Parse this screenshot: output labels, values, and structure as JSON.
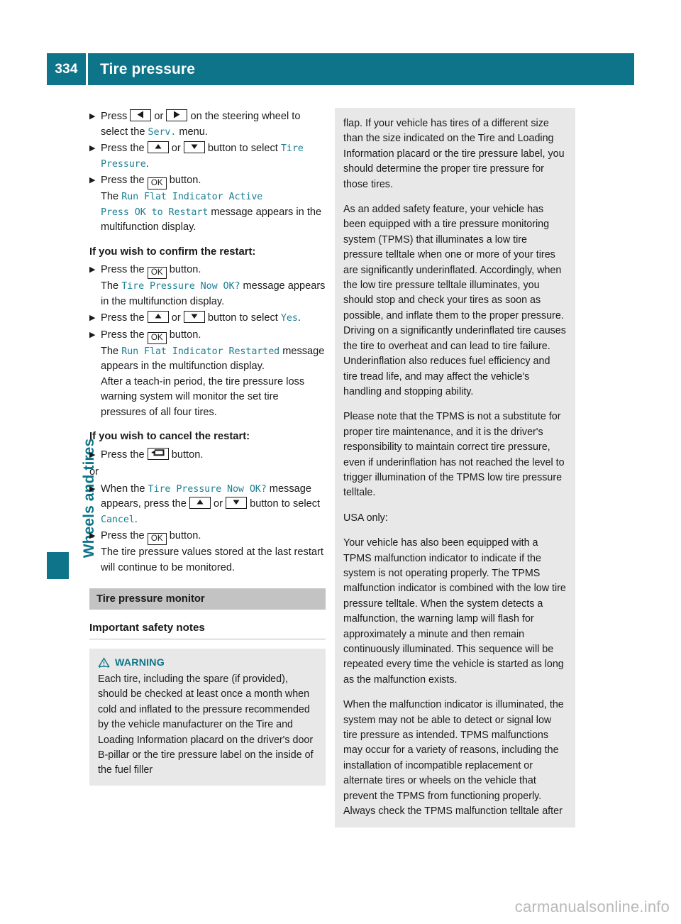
{
  "header": {
    "page_number": "334",
    "title": "Tire pressure",
    "accent_color": "#0d7489"
  },
  "side_tab": {
    "label": "Wheels and tires"
  },
  "keys": {
    "left": "left-arrow",
    "right": "right-arrow",
    "up": "up-arrow",
    "down": "down-arrow",
    "ok": "OK",
    "back": "back-arrow"
  },
  "left_column": {
    "steps_restart": [
      {
        "pre": "Press ",
        "mid": " or ",
        "post": " on the steering wheel to select the ",
        "disp": "Serv.",
        "tail": " menu."
      },
      {
        "pre": "Press the ",
        "mid": " or ",
        "post": " button to select ",
        "disp": "Tire Pressure",
        "tail": "."
      }
    ],
    "step_ok_1": {
      "pre": "Press the ",
      "post": " button.",
      "result_pre": "The ",
      "result_disp_1": "Run Flat Indicator Active",
      "result_disp_2": "Press OK to Restart",
      "result_tail": " message appears in the multifunction display."
    },
    "confirm_heading": "If you wish to confirm the restart:",
    "confirm_steps": [
      {
        "pre": "Press the ",
        "post": " button.",
        "result_pre": "The ",
        "result_disp": "Tire Pressure Now OK?",
        "result_tail": " message appears in the multifunction display."
      },
      {
        "pre": "Press the ",
        "mid": " or ",
        "post": " button to select ",
        "disp": "Yes",
        "tail": "."
      },
      {
        "pre": "Press the ",
        "post": " button.",
        "result_pre": "The ",
        "result_disp": "Run Flat Indicator Restarted",
        "result_tail": " message appears in the multifunction display."
      }
    ],
    "teach_in_note": "After a teach-in period, the tire pressure loss warning system will monitor the set tire pressures of all four tires.",
    "cancel_heading": "If you wish to cancel the restart:",
    "cancel_step_back": {
      "pre": "Press the ",
      "post": " button."
    },
    "or_label": "or",
    "cancel_step_when": {
      "pre": "When the ",
      "disp": "Tire Pressure Now OK?",
      "mid": " message appears, press the ",
      "mid2": " or ",
      "post": " button to select ",
      "disp2": "Cancel",
      "tail": "."
    },
    "cancel_step_ok": {
      "pre": "Press the ",
      "post": " button.",
      "result": "The tire pressure values stored at the last restart will continue to be monitored."
    },
    "section_bar": "Tire pressure monitor",
    "subhead": "Important safety notes",
    "warning": {
      "icon": "warning-triangle-icon",
      "label": "WARNING",
      "text": "Each tire, including the spare (if provided), should be checked at least once a month when cold and inflated to the pressure recommended by the vehicle manufacturer on the Tire and Loading Information placard on the driver's door B-pillar or the tire pressure label on the inside of the fuel filler"
    }
  },
  "right_column": {
    "warning_continued": [
      "flap. If your vehicle has tires of a different size than the size indicated on the Tire and Loading Information placard or the tire pressure label, you should determine the proper tire pressure for those tires.",
      "As an added safety feature, your vehicle has been equipped with a tire pressure monitoring system (TPMS) that illuminates a low tire pressure telltale when one or more of your tires are significantly underinflated. Accordingly, when the low tire pressure telltale illuminates, you should stop and check your tires as soon as possible, and inflate them to the proper pressure. Driving on a significantly underinflated tire causes the tire to overheat and can lead to tire failure. Underinflation also reduces fuel efficiency and tire tread life, and may affect the vehicle's handling and stopping ability.",
      "Please note that the TPMS is not a substitute for proper tire maintenance, and it is the driver's responsibility to maintain correct tire pressure, even if underinflation has not reached the level to trigger illumination of the TPMS low tire pressure telltale.",
      "USA only:",
      "Your vehicle has also been equipped with a TPMS malfunction indicator to indicate if the system is not operating properly. The TPMS malfunction indicator is combined with the low tire pressure telltale. When the system detects a malfunction, the warning lamp will flash for approximately a minute and then remain continuously illuminated. This sequence will be repeated every time the vehicle is started as long as the malfunction exists.",
      "When the malfunction indicator is illuminated, the system may not be able to detect or signal low tire pressure as intended. TPMS malfunctions may occur for a variety of reasons, including the installation of incompatible replacement or alternate tires or wheels on the vehicle that prevent the TPMS from functioning properly. Always check the TPMS malfunction telltale after"
    ]
  },
  "watermark": "carmanualsonline.info"
}
